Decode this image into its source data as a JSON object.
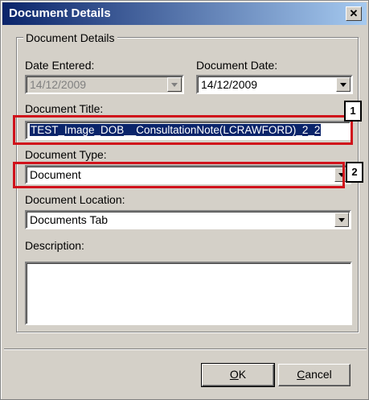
{
  "window": {
    "title": "Document Details"
  },
  "group": {
    "legend": "Document Details"
  },
  "date_entered": {
    "label": "Date Entered:",
    "value": "14/12/2009"
  },
  "document_date": {
    "label": "Document Date:",
    "value": "14/12/2009"
  },
  "document_title": {
    "label": "Document Title:",
    "value": "TEST_Image_DOB__ConsultationNote(LCRAWFORD)_2_2"
  },
  "document_type": {
    "label": "Document Type:",
    "value": "Document"
  },
  "document_location": {
    "label": "Document Location:",
    "value": "Documents Tab"
  },
  "description": {
    "label": "Description:",
    "value": ""
  },
  "callouts": {
    "one": "1",
    "two": "2"
  },
  "buttons": {
    "ok_mnemonic": "O",
    "ok_rest": "K",
    "cancel_mnemonic": "C",
    "cancel_rest": "ancel"
  },
  "colors": {
    "highlight": "#d0121b",
    "titlebar_start": "#0a246a",
    "titlebar_end": "#a6caf0",
    "face": "#d4d0c8"
  }
}
